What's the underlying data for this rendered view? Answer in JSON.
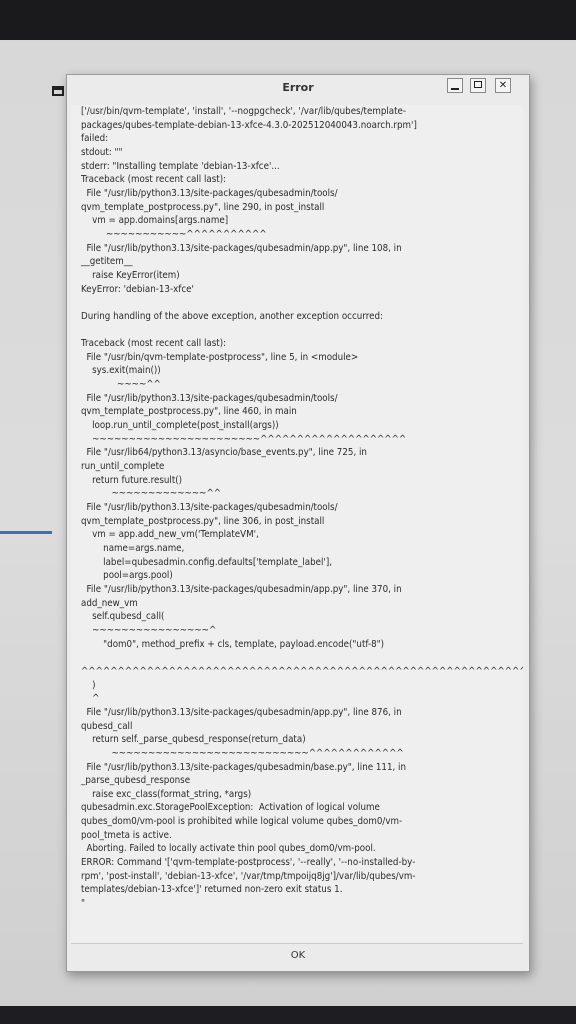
{
  "dialog": {
    "title": "Error",
    "ok_label": "OK",
    "log_lines": [
      "['/usr/bin/qvm-template', 'install', '--nogpgcheck', '/var/lib/qubes/template-",
      "packages/qubes-template-debian-13-xfce-4.3.0-202512040043.noarch.rpm']",
      "failed:",
      "stdout: \"\"",
      "stderr: \"Installing template 'debian-13-xfce'...",
      "Traceback (most recent call last):",
      "  File \"/usr/lib/python3.13/site-packages/qubesadmin/tools/",
      "qvm_template_postprocess.py\", line 290, in post_install",
      "    vm = app.domains[args.name]",
      "         ~~~~~~~~~~~^^^^^^^^^^^",
      "  File \"/usr/lib/python3.13/site-packages/qubesadmin/app.py\", line 108, in",
      "__getitem__",
      "    raise KeyError(item)",
      "KeyError: 'debian-13-xfce'",
      "",
      "During handling of the above exception, another exception occurred:",
      "",
      "Traceback (most recent call last):",
      "  File \"/usr/bin/qvm-template-postprocess\", line 5, in <module>",
      "    sys.exit(main())",
      "             ~~~~^^",
      "  File \"/usr/lib/python3.13/site-packages/qubesadmin/tools/",
      "qvm_template_postprocess.py\", line 460, in main",
      "    loop.run_until_complete(post_install(args))",
      "    ~~~~~~~~~~~~~~~~~~~~~~~^^^^^^^^^^^^^^^^^^^^",
      "  File \"/usr/lib64/python3.13/asyncio/base_events.py\", line 725, in",
      "run_until_complete",
      "    return future.result()",
      "           ~~~~~~~~~~~~~^^",
      "  File \"/usr/lib/python3.13/site-packages/qubesadmin/tools/",
      "qvm_template_postprocess.py\", line 306, in post_install",
      "    vm = app.add_new_vm('TemplateVM',",
      "        name=args.name,",
      "        label=qubesadmin.config.defaults['template_label'],",
      "        pool=args.pool)",
      "  File \"/usr/lib/python3.13/site-packages/qubesadmin/app.py\", line 370, in",
      "add_new_vm",
      "    self.qubesd_call(",
      "    ~~~~~~~~~~~~~~~~^",
      "        \"dom0\", method_prefix + cls, template, payload.encode(\"utf-8\")",
      "",
      "^^^^^^^^^^^^^^^^^^^^^^^^^^^^^^^^^^^^^^^^^^^^^^^^^^^^^^^^^^^^^^^^^^",
      "    )",
      "    ^",
      "  File \"/usr/lib/python3.13/site-packages/qubesadmin/app.py\", line 876, in",
      "qubesd_call",
      "    return self._parse_qubesd_response(return_data)",
      "           ~~~~~~~~~~~~~~~~~~~~~~~~~~~^^^^^^^^^^^^^",
      "  File \"/usr/lib/python3.13/site-packages/qubesadmin/base.py\", line 111, in",
      "_parse_qubesd_response",
      "    raise exc_class(format_string, *args)",
      "qubesadmin.exc.StoragePoolException:  Activation of logical volume",
      "qubes_dom0/vm-pool is prohibited while logical volume qubes_dom0/vm-",
      "pool_tmeta is active.",
      "  Aborting. Failed to locally activate thin pool qubes_dom0/vm-pool.",
      "ERROR: Command '['qvm-template-postprocess', '--really', '--no-installed-by-",
      "rpm', 'post-install', 'debian-13-xfce', '/var/tmp/tmpoijq8jg']/var/lib/qubes/vm-",
      "templates/debian-13-xfce']' returned non-zero exit status 1.",
      "\""
    ]
  },
  "icons": {
    "minimize": "minimize-icon",
    "maximize": "maximize-icon",
    "close": "close-icon",
    "close_glyph": "✕"
  }
}
